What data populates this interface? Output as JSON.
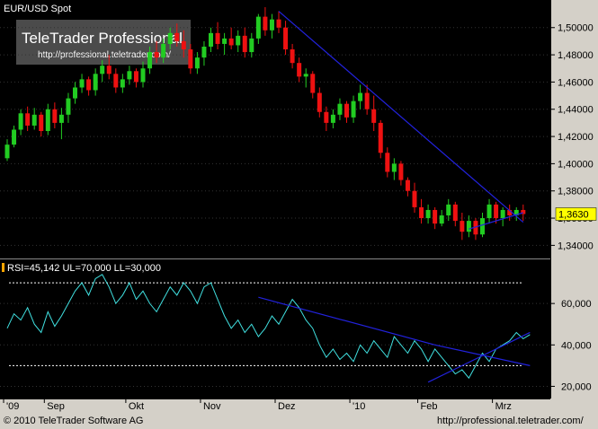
{
  "chart_data": [
    {
      "type": "candlestick",
      "title": "EUR/USD Spot",
      "y_ticks": [
        "1,34000",
        "1,36000",
        "1,38000",
        "1,40000",
        "1,42000",
        "1,44000",
        "1,46000",
        "1,48000",
        "1,50000"
      ],
      "ylim": [
        1.333,
        1.515
      ],
      "last_price_label": "1,3630",
      "colors": {
        "up": "#22cc22",
        "down": "#ee1111",
        "trend": "#2222dd"
      },
      "candles": [
        {
          "o": 1.404,
          "h": 1.418,
          "l": 1.402,
          "c": 1.414
        },
        {
          "o": 1.414,
          "h": 1.428,
          "l": 1.412,
          "c": 1.425
        },
        {
          "o": 1.425,
          "h": 1.44,
          "l": 1.421,
          "c": 1.437
        },
        {
          "o": 1.437,
          "h": 1.442,
          "l": 1.424,
          "c": 1.428
        },
        {
          "o": 1.428,
          "h": 1.441,
          "l": 1.425,
          "c": 1.436
        },
        {
          "o": 1.436,
          "h": 1.438,
          "l": 1.42,
          "c": 1.424
        },
        {
          "o": 1.424,
          "h": 1.444,
          "l": 1.421,
          "c": 1.44
        },
        {
          "o": 1.44,
          "h": 1.445,
          "l": 1.426,
          "c": 1.43
        },
        {
          "o": 1.43,
          "h": 1.441,
          "l": 1.418,
          "c": 1.436
        },
        {
          "o": 1.436,
          "h": 1.452,
          "l": 1.43,
          "c": 1.448
        },
        {
          "o": 1.448,
          "h": 1.46,
          "l": 1.444,
          "c": 1.456
        },
        {
          "o": 1.456,
          "h": 1.466,
          "l": 1.452,
          "c": 1.462
        },
        {
          "o": 1.462,
          "h": 1.464,
          "l": 1.45,
          "c": 1.454
        },
        {
          "o": 1.454,
          "h": 1.47,
          "l": 1.45,
          "c": 1.466
        },
        {
          "o": 1.466,
          "h": 1.476,
          "l": 1.46,
          "c": 1.472
        },
        {
          "o": 1.472,
          "h": 1.48,
          "l": 1.462,
          "c": 1.466
        },
        {
          "o": 1.466,
          "h": 1.47,
          "l": 1.452,
          "c": 1.456
        },
        {
          "o": 1.456,
          "h": 1.466,
          "l": 1.452,
          "c": 1.462
        },
        {
          "o": 1.462,
          "h": 1.472,
          "l": 1.458,
          "c": 1.468
        },
        {
          "o": 1.468,
          "h": 1.47,
          "l": 1.456,
          "c": 1.46
        },
        {
          "o": 1.46,
          "h": 1.475,
          "l": 1.456,
          "c": 1.47
        },
        {
          "o": 1.47,
          "h": 1.486,
          "l": 1.466,
          "c": 1.482
        },
        {
          "o": 1.482,
          "h": 1.49,
          "l": 1.474,
          "c": 1.478
        },
        {
          "o": 1.478,
          "h": 1.492,
          "l": 1.474,
          "c": 1.488
        },
        {
          "o": 1.488,
          "h": 1.5,
          "l": 1.484,
          "c": 1.496
        },
        {
          "o": 1.496,
          "h": 1.503,
          "l": 1.486,
          "c": 1.49
        },
        {
          "o": 1.49,
          "h": 1.498,
          "l": 1.478,
          "c": 1.484
        },
        {
          "o": 1.484,
          "h": 1.488,
          "l": 1.466,
          "c": 1.47
        },
        {
          "o": 1.47,
          "h": 1.482,
          "l": 1.466,
          "c": 1.478
        },
        {
          "o": 1.478,
          "h": 1.49,
          "l": 1.472,
          "c": 1.486
        },
        {
          "o": 1.486,
          "h": 1.5,
          "l": 1.482,
          "c": 1.496
        },
        {
          "o": 1.496,
          "h": 1.504,
          "l": 1.484,
          "c": 1.488
        },
        {
          "o": 1.488,
          "h": 1.496,
          "l": 1.48,
          "c": 1.492
        },
        {
          "o": 1.492,
          "h": 1.5,
          "l": 1.484,
          "c": 1.487
        },
        {
          "o": 1.487,
          "h": 1.498,
          "l": 1.482,
          "c": 1.494
        },
        {
          "o": 1.494,
          "h": 1.5,
          "l": 1.478,
          "c": 1.482
        },
        {
          "o": 1.482,
          "h": 1.496,
          "l": 1.478,
          "c": 1.492
        },
        {
          "o": 1.492,
          "h": 1.51,
          "l": 1.488,
          "c": 1.508
        },
        {
          "o": 1.508,
          "h": 1.515,
          "l": 1.494,
          "c": 1.498
        },
        {
          "o": 1.498,
          "h": 1.51,
          "l": 1.492,
          "c": 1.506
        },
        {
          "o": 1.506,
          "h": 1.512,
          "l": 1.496,
          "c": 1.5
        },
        {
          "o": 1.5,
          "h": 1.505,
          "l": 1.48,
          "c": 1.484
        },
        {
          "o": 1.484,
          "h": 1.488,
          "l": 1.47,
          "c": 1.474
        },
        {
          "o": 1.474,
          "h": 1.478,
          "l": 1.46,
          "c": 1.464
        },
        {
          "o": 1.464,
          "h": 1.47,
          "l": 1.456,
          "c": 1.466
        },
        {
          "o": 1.466,
          "h": 1.468,
          "l": 1.448,
          "c": 1.452
        },
        {
          "o": 1.452,
          "h": 1.456,
          "l": 1.434,
          "c": 1.438
        },
        {
          "o": 1.438,
          "h": 1.442,
          "l": 1.424,
          "c": 1.43
        },
        {
          "o": 1.43,
          "h": 1.44,
          "l": 1.426,
          "c": 1.436
        },
        {
          "o": 1.436,
          "h": 1.448,
          "l": 1.432,
          "c": 1.444
        },
        {
          "o": 1.444,
          "h": 1.446,
          "l": 1.43,
          "c": 1.434
        },
        {
          "o": 1.434,
          "h": 1.45,
          "l": 1.43,
          "c": 1.446
        },
        {
          "o": 1.446,
          "h": 1.458,
          "l": 1.44,
          "c": 1.452
        },
        {
          "o": 1.452,
          "h": 1.458,
          "l": 1.436,
          "c": 1.44
        },
        {
          "o": 1.44,
          "h": 1.45,
          "l": 1.424,
          "c": 1.43
        },
        {
          "o": 1.43,
          "h": 1.432,
          "l": 1.404,
          "c": 1.408
        },
        {
          "o": 1.408,
          "h": 1.412,
          "l": 1.39,
          "c": 1.394
        },
        {
          "o": 1.394,
          "h": 1.404,
          "l": 1.388,
          "c": 1.4
        },
        {
          "o": 1.4,
          "h": 1.402,
          "l": 1.384,
          "c": 1.388
        },
        {
          "o": 1.388,
          "h": 1.39,
          "l": 1.376,
          "c": 1.38
        },
        {
          "o": 1.38,
          "h": 1.386,
          "l": 1.364,
          "c": 1.368
        },
        {
          "o": 1.368,
          "h": 1.374,
          "l": 1.356,
          "c": 1.36
        },
        {
          "o": 1.36,
          "h": 1.37,
          "l": 1.356,
          "c": 1.366
        },
        {
          "o": 1.366,
          "h": 1.368,
          "l": 1.352,
          "c": 1.356
        },
        {
          "o": 1.356,
          "h": 1.366,
          "l": 1.354,
          "c": 1.362
        },
        {
          "o": 1.362,
          "h": 1.374,
          "l": 1.358,
          "c": 1.37
        },
        {
          "o": 1.37,
          "h": 1.372,
          "l": 1.354,
          "c": 1.358
        },
        {
          "o": 1.358,
          "h": 1.364,
          "l": 1.344,
          "c": 1.35
        },
        {
          "o": 1.35,
          "h": 1.362,
          "l": 1.346,
          "c": 1.358
        },
        {
          "o": 1.358,
          "h": 1.36,
          "l": 1.344,
          "c": 1.348
        },
        {
          "o": 1.348,
          "h": 1.364,
          "l": 1.346,
          "c": 1.36
        },
        {
          "o": 1.36,
          "h": 1.374,
          "l": 1.356,
          "c": 1.37
        },
        {
          "o": 1.37,
          "h": 1.372,
          "l": 1.356,
          "c": 1.36
        },
        {
          "o": 1.36,
          "h": 1.368,
          "l": 1.354,
          "c": 1.366
        },
        {
          "o": 1.366,
          "h": 1.37,
          "l": 1.358,
          "c": 1.362
        },
        {
          "o": 1.362,
          "h": 1.368,
          "l": 1.358,
          "c": 1.366
        },
        {
          "o": 1.366,
          "h": 1.37,
          "l": 1.358,
          "c": 1.363
        }
      ],
      "trendlines": [
        {
          "from": [
            40,
            1.512
          ],
          "to": [
            76,
            1.357
          ]
        },
        {
          "from": [
            68,
            1.352
          ],
          "to": [
            76,
            1.364
          ]
        }
      ]
    },
    {
      "type": "line",
      "label": "RSI=45,142 UL=70,000 LL=30,000",
      "y_ticks": [
        "20,000",
        "40,000",
        "60,000"
      ],
      "ylim": [
        15,
        80
      ],
      "upper_level": 70,
      "lower_level": 30,
      "colors": {
        "line": "#40e0e0",
        "trend": "#2222dd",
        "level": "#ffffff"
      },
      "values": [
        48,
        55,
        52,
        58,
        50,
        46,
        56,
        49,
        54,
        60,
        66,
        70,
        64,
        72,
        74,
        68,
        60,
        64,
        70,
        62,
        66,
        60,
        56,
        62,
        68,
        64,
        70,
        66,
        60,
        68,
        70,
        62,
        54,
        48,
        52,
        46,
        50,
        44,
        48,
        54,
        50,
        56,
        62,
        58,
        52,
        48,
        40,
        34,
        38,
        33,
        36,
        32,
        40,
        36,
        42,
        38,
        34,
        44,
        40,
        36,
        42,
        38,
        32,
        38,
        34,
        30,
        26,
        28,
        24,
        30,
        36,
        32,
        38,
        40,
        42,
        46,
        43,
        45
      ],
      "trendlines": [
        {
          "from": [
            37,
            63
          ],
          "to": [
            63,
            40
          ]
        },
        {
          "from": [
            63,
            40
          ],
          "to": [
            77,
            30
          ]
        },
        {
          "from": [
            62,
            22
          ],
          "to": [
            77,
            46
          ]
        }
      ]
    }
  ],
  "x_labels": [
    "'09",
    "Sep",
    "Okt",
    "Nov",
    "Dez",
    "'10",
    "Feb",
    "Mrz"
  ],
  "footer": {
    "copyright": "© 2010 TeleTrader Software AG",
    "url": "http://professional.teletrader.com/"
  },
  "watermark": {
    "brand": "TeleTrader Professional",
    "url": "http://professional.teletrader.com/"
  }
}
